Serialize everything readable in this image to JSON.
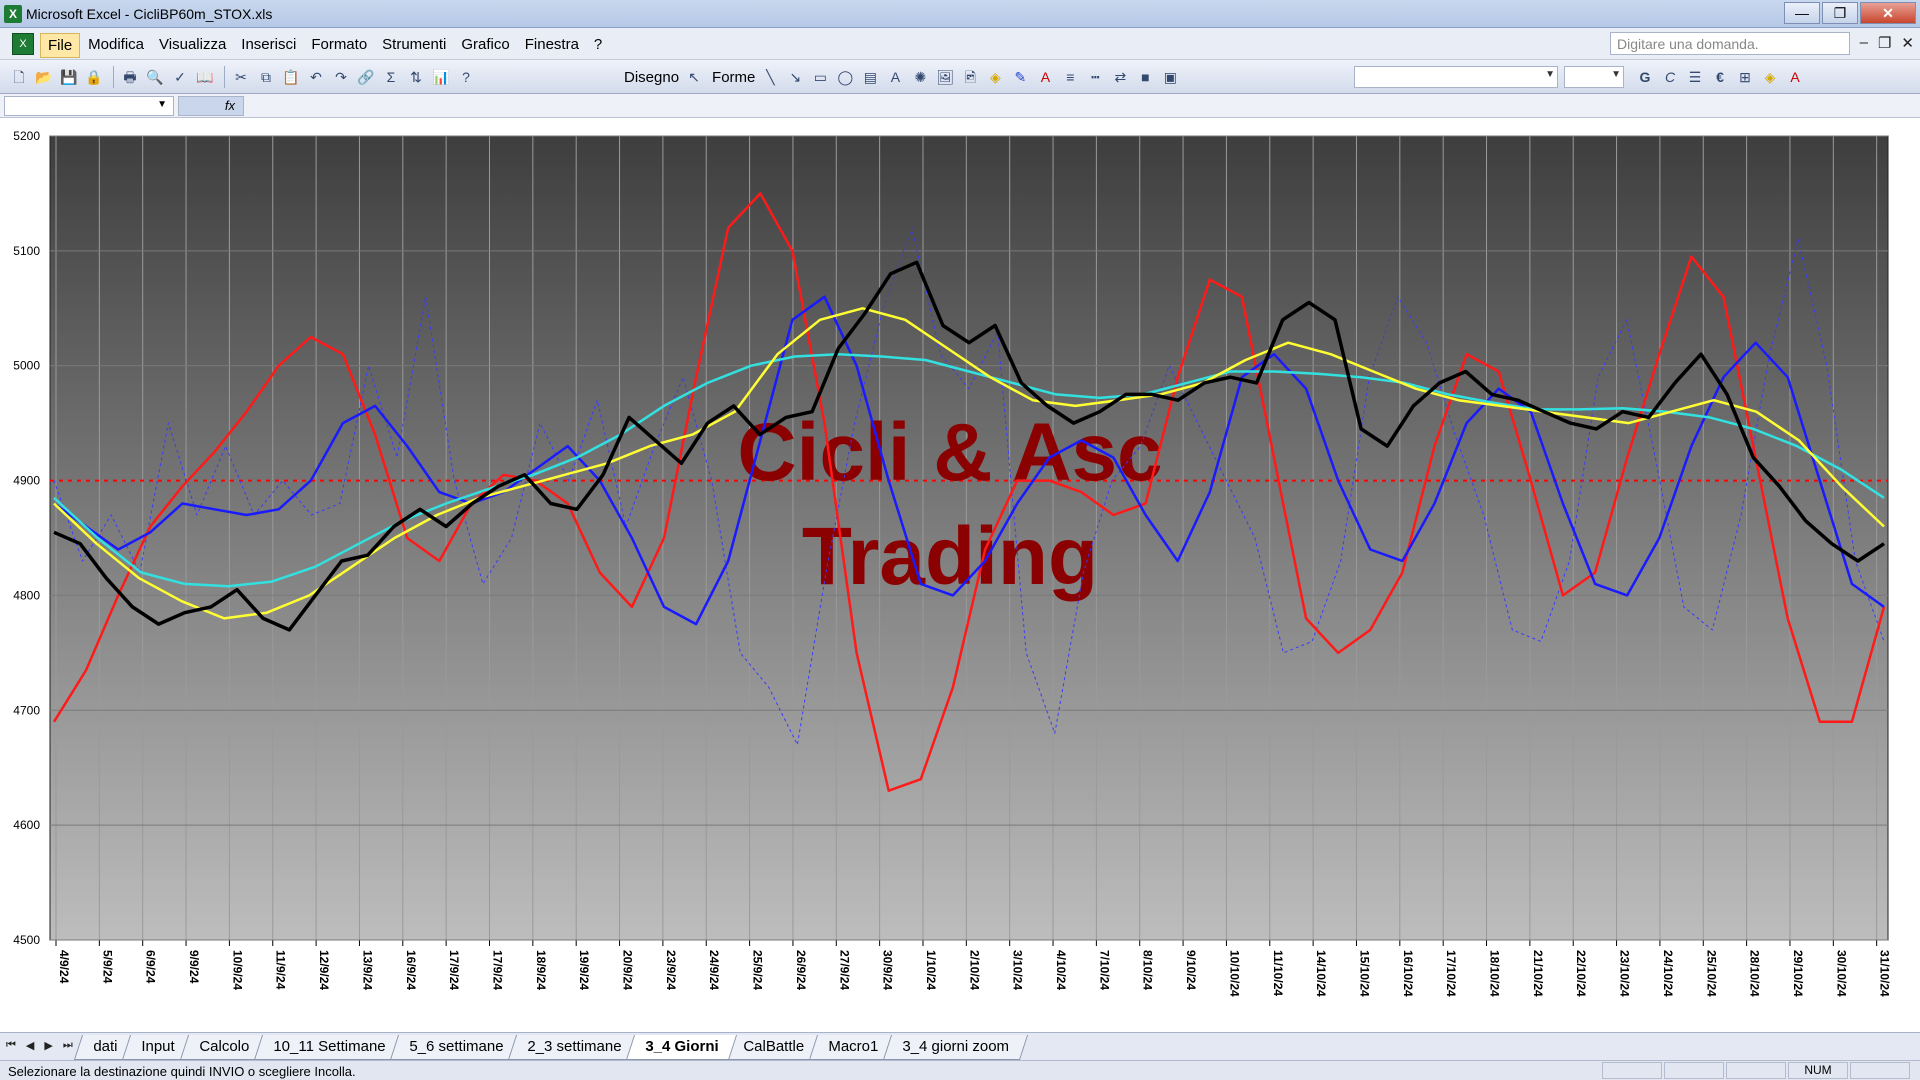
{
  "window": {
    "title": "Microsoft Excel - CicliBP60m_STOX.xls",
    "controls": [
      "—",
      "❐",
      "✕"
    ]
  },
  "menubar": {
    "items": [
      "File",
      "Modifica",
      "Visualizza",
      "Inserisci",
      "Formato",
      "Strumenti",
      "Grafico",
      "Finestra",
      "?"
    ],
    "ask_placeholder": "Digitare una domanda.",
    "doc_controls": [
      "–",
      "❐",
      "✕"
    ]
  },
  "toolbar": {
    "draw_label": "Disegno",
    "shapes_label": "Forme",
    "bold": "G",
    "italic": "C",
    "euro": "€"
  },
  "formula_bar": {
    "fx": "fx"
  },
  "chart_data": {
    "type": "line",
    "title": "",
    "watermark": [
      "Cicli & Asc",
      "Trading"
    ],
    "ylim": [
      4500,
      5200
    ],
    "yticks": [
      4500,
      4600,
      4700,
      4800,
      4900,
      5000,
      5100,
      5200
    ],
    "reference_line": 4900,
    "x_labels": [
      "4/9/24",
      "5/9/24",
      "6/9/24",
      "9/9/24",
      "10/9/24",
      "11/9/24",
      "12/9/24",
      "13/9/24",
      "16/9/24",
      "17/9/24",
      "17/9/24",
      "18/9/24",
      "19/9/24",
      "20/9/24",
      "23/9/24",
      "24/9/24",
      "25/9/24",
      "26/9/24",
      "27/9/24",
      "30/9/24",
      "1/10/24",
      "2/10/24",
      "3/10/24",
      "4/10/24",
      "7/10/24",
      "8/10/24",
      "9/10/24",
      "10/10/24",
      "11/10/24",
      "14/10/24",
      "15/10/24",
      "16/10/24",
      "17/10/24",
      "18/10/24",
      "21/10/24",
      "22/10/24",
      "23/10/24",
      "24/10/24",
      "25/10/24",
      "28/10/24",
      "29/10/24",
      "30/10/24",
      "31/10/24"
    ],
    "grid": true,
    "colors": {
      "price": "#000000",
      "red": "#ff1a1a",
      "blue": "#1a1aff",
      "yellow": "#ffff33",
      "cyan": "#33e0e0",
      "ref": "#ff0000"
    },
    "series": [
      {
        "name": "price",
        "color": "#000000",
        "values": [
          4855,
          4845,
          4815,
          4790,
          4775,
          4785,
          4790,
          4805,
          4780,
          4770,
          4800,
          4830,
          4835,
          4860,
          4875,
          4860,
          4880,
          4895,
          4905,
          4880,
          4875,
          4905,
          4955,
          4935,
          4915,
          4950,
          4965,
          4940,
          4955,
          4960,
          5015,
          5045,
          5080,
          5090,
          5035,
          5020,
          5035,
          4985,
          4965,
          4950,
          4960,
          4975,
          4975,
          4970,
          4985,
          4990,
          4985,
          5040,
          5055,
          5040,
          4945,
          4930,
          4965,
          4985,
          4995,
          4975,
          4970,
          4960,
          4950,
          4945,
          4960,
          4955,
          4985,
          5010,
          4975,
          4920,
          4895,
          4865,
          4845,
          4830,
          4845
        ]
      },
      {
        "name": "red",
        "color": "#ff1a1a",
        "values": [
          4690,
          4735,
          4800,
          4860,
          4895,
          4925,
          4960,
          5000,
          5025,
          5010,
          4940,
          4850,
          4830,
          4880,
          4905,
          4900,
          4880,
          4820,
          4790,
          4850,
          4990,
          5120,
          5150,
          5100,
          4950,
          4750,
          4630,
          4640,
          4720,
          4840,
          4900,
          4900,
          4890,
          4870,
          4880,
          4990,
          5075,
          5060,
          4920,
          4780,
          4750,
          4770,
          4820,
          4930,
          5010,
          4995,
          4900,
          4800,
          4820,
          4920,
          5010,
          5095,
          5060,
          4920,
          4780,
          4690,
          4690,
          4790
        ]
      },
      {
        "name": "blue",
        "color": "#1a1aff",
        "values": [
          4880,
          4860,
          4840,
          4855,
          4880,
          4875,
          4870,
          4875,
          4900,
          4950,
          4965,
          4930,
          4890,
          4880,
          4890,
          4910,
          4930,
          4900,
          4850,
          4790,
          4775,
          4830,
          4935,
          5040,
          5060,
          5000,
          4900,
          4810,
          4800,
          4830,
          4880,
          4920,
          4935,
          4920,
          4870,
          4830,
          4890,
          4990,
          5010,
          4980,
          4900,
          4840,
          4830,
          4880,
          4950,
          4980,
          4960,
          4880,
          4810,
          4800,
          4850,
          4930,
          4990,
          5020,
          4990,
          4900,
          4810,
          4790
        ]
      },
      {
        "name": "yellow",
        "color": "#ffff33",
        "values": [
          4880,
          4845,
          4815,
          4795,
          4780,
          4785,
          4800,
          4825,
          4850,
          4870,
          4885,
          4895,
          4905,
          4915,
          4930,
          4940,
          4960,
          5010,
          5040,
          5050,
          5040,
          5015,
          4990,
          4970,
          4965,
          4970,
          4975,
          4985,
          5005,
          5020,
          5010,
          4995,
          4980,
          4970,
          4965,
          4960,
          4955,
          4950,
          4960,
          4970,
          4960,
          4935,
          4895,
          4860
        ]
      },
      {
        "name": "cyan",
        "color": "#33e0e0",
        "values": [
          4885,
          4850,
          4820,
          4810,
          4808,
          4812,
          4825,
          4845,
          4865,
          4880,
          4893,
          4905,
          4920,
          4940,
          4965,
          4985,
          5000,
          5008,
          5010,
          5008,
          5005,
          4995,
          4985,
          4975,
          4972,
          4975,
          4985,
          4995,
          4995,
          4993,
          4990,
          4985,
          4975,
          4968,
          4962,
          4962,
          4963,
          4960,
          4955,
          4945,
          4930,
          4910,
          4885
        ]
      },
      {
        "name": "dotted",
        "color": "#3a3aff",
        "values": [
          4900,
          4830,
          4870,
          4820,
          4950,
          4870,
          4930,
          4870,
          4900,
          4870,
          4880,
          5000,
          4920,
          5060,
          4900,
          4810,
          4850,
          4950,
          4900,
          4970,
          4860,
          4930,
          4990,
          4900,
          4750,
          4720,
          4670,
          4820,
          4950,
          5050,
          5120,
          5010,
          4980,
          5030,
          4750,
          4680,
          4820,
          4900,
          4930,
          5000,
          4950,
          4900,
          4850,
          4750,
          4760,
          4830,
          4990,
          5060,
          5020,
          4940,
          4870,
          4770,
          4760,
          4830,
          4990,
          5040,
          4920,
          4790,
          4770,
          4870,
          5010,
          5110,
          5000,
          4830,
          4760
        ]
      }
    ]
  },
  "sheets": {
    "nav": [
      "⏮",
      "◀",
      "▶",
      "⏭"
    ],
    "tabs": [
      "dati",
      "Input",
      "Calcolo",
      "10_11 Settimane",
      "5_6 settimane",
      "2_3 settimane",
      "3_4 Giorni",
      "CalBattle",
      "Macro1",
      "3_4 giorni zoom"
    ],
    "active": "3_4 Giorni"
  },
  "status": {
    "message": "Selezionare la destinazione quindi INVIO o scegliere Incolla.",
    "num": "NUM"
  }
}
